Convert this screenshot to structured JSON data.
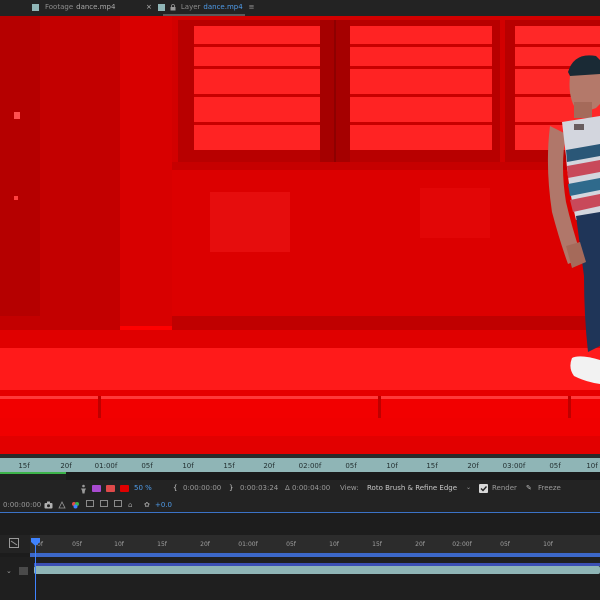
{
  "tabs": [
    {
      "prefix": "Footage",
      "name": "dance.mp4",
      "active": false
    },
    {
      "prefix": "Layer",
      "name": "dance.mp4",
      "active": true
    }
  ],
  "icons": {
    "tab_close": "×",
    "tab_lock": "lock-icon",
    "tab_menu": "≡",
    "snapshot": "camera-icon"
  },
  "ruler1": {
    "labels": [
      "15f",
      "20f",
      "01:00f",
      "05f",
      "10f",
      "15f",
      "20f",
      "02:00f",
      "05f",
      "10f",
      "15f",
      "20f",
      "03:00f",
      "05f",
      "10f"
    ]
  },
  "viewer_controls": {
    "zoom": "50 %",
    "in_time": "0:00:00:00",
    "out_time": "0:00:03:24",
    "duration": "Δ 0:00:04:00",
    "view_label": "View:",
    "view_value": "Roto Brush & Refine Edge",
    "render_label": "Render",
    "freeze_label": "Freeze"
  },
  "viewer_controls2": {
    "current_time": "0:00:00:00",
    "exposure": "+0.0"
  },
  "timeline": {
    "labels": [
      "0f",
      "05f",
      "10f",
      "15f",
      "20f",
      "01:00f",
      "05f",
      "10f",
      "15f",
      "20f",
      "02:00f",
      "05f",
      "10f"
    ]
  },
  "colors": {
    "overlay": "#ff0000",
    "ruler_teal": "#8fb5b6",
    "accent_blue": "#3f83ff",
    "work_area_green": "#3cb34a"
  }
}
